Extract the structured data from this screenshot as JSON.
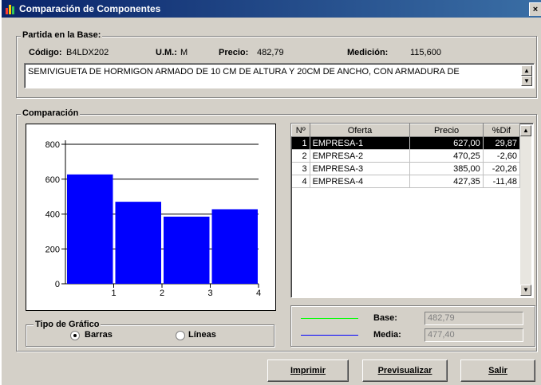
{
  "window": {
    "title": "Comparación de Componentes",
    "close_glyph": "×"
  },
  "partida": {
    "group_label": "Partida en la Base:",
    "codigo_label": "Código:",
    "codigo_value": "B4LDX202",
    "um_label": "U.M.:",
    "um_value": "M",
    "precio_label": "Precio:",
    "precio_value": "482,79",
    "medicion_label": "Medición:",
    "medicion_value": "115,600",
    "description": "SEMIVIGUETA DE HORMIGON ARMADO DE 10 CM DE ALTURA Y 20CM DE ANCHO, CON ARMADURA DE"
  },
  "comparacion": {
    "group_label": "Comparación"
  },
  "table": {
    "headers": [
      "Nº",
      "Oferta",
      "Precio",
      "%Dif"
    ],
    "rows": [
      {
        "n": "1",
        "oferta": "EMPRESA-1",
        "precio": "627,00",
        "dif": "29,87",
        "selected": true
      },
      {
        "n": "2",
        "oferta": "EMPRESA-2",
        "precio": "470,25",
        "dif": "-2,60",
        "selected": false
      },
      {
        "n": "3",
        "oferta": "EMPRESA-3",
        "precio": "385,00",
        "dif": "-20,26",
        "selected": false
      },
      {
        "n": "4",
        "oferta": "EMPRESA-4",
        "precio": "427,35",
        "dif": "-11,48",
        "selected": false
      }
    ]
  },
  "chart_data": {
    "type": "bar",
    "categories": [
      "1",
      "2",
      "3",
      "4"
    ],
    "values": [
      627.0,
      470.25,
      385.0,
      427.35
    ],
    "yticks": [
      "0",
      "200",
      "400",
      "600",
      "800"
    ],
    "ylim": [
      0,
      800
    ],
    "grid": true,
    "bar_color": "#0000ff"
  },
  "legend": {
    "base_label": "Base:",
    "base_value": "482,79",
    "base_color": "#00ff00",
    "media_label": "Media:",
    "media_value": "477,40",
    "media_color": "#0000ff"
  },
  "tipo": {
    "group_label": "Tipo de Gráfico",
    "barras": "Barras",
    "lineas": "Líneas",
    "selected": "barras"
  },
  "buttons": {
    "imprimir": "Imprimir",
    "previsualizar": "Previsualizar",
    "salir": "Salir"
  }
}
